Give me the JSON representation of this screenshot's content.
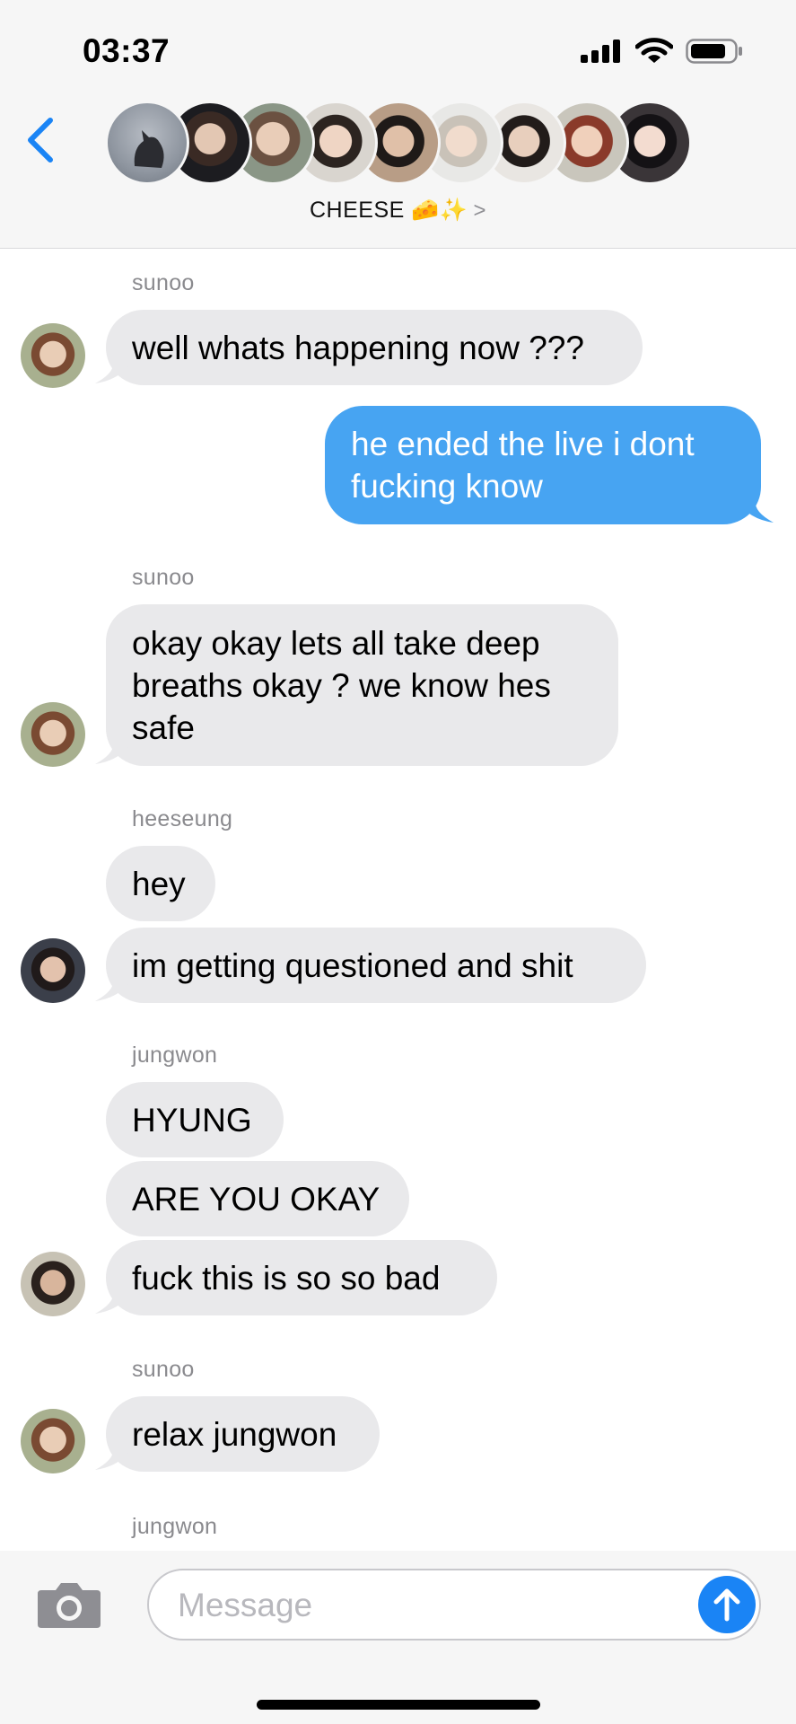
{
  "status_bar": {
    "time": "03:37"
  },
  "header": {
    "group_name": "CHEESE 🧀✨",
    "chevron": ">",
    "member_avatars": [
      "avatar-cat",
      "avatar-1",
      "avatar-2",
      "avatar-3",
      "avatar-4",
      "avatar-5",
      "avatar-6",
      "avatar-7",
      "avatar-8"
    ]
  },
  "messages": [
    {
      "sender": "sunoo",
      "text": "well whats happening now ???",
      "direction": "incoming"
    },
    {
      "text_lines": [
        "he ended the live i dont",
        "fucking know"
      ],
      "direction": "outgoing"
    },
    {
      "sender": "sunoo",
      "text_lines": [
        "okay okay lets all take deep",
        "breaths okay ? we know hes",
        "safe"
      ],
      "direction": "incoming"
    },
    {
      "sender": "heeseung",
      "texts": [
        "hey",
        "im getting questioned and shit"
      ],
      "direction": "incoming"
    },
    {
      "sender": "jungwon",
      "texts": [
        "HYUNG",
        "ARE YOU OKAY",
        "fuck this is so so bad"
      ],
      "direction": "incoming"
    },
    {
      "sender": "sunoo",
      "text": "relax jungwon",
      "direction": "incoming"
    },
    {
      "sender": "jungwon",
      "direction": "incoming"
    }
  ],
  "input_bar": {
    "placeholder": "Message"
  },
  "colors": {
    "incoming_bubble": "#e9e9eb",
    "outgoing_bubble": "#47a4f2",
    "send_button": "#1a84f5",
    "back_chevron": "#1a84f5"
  }
}
